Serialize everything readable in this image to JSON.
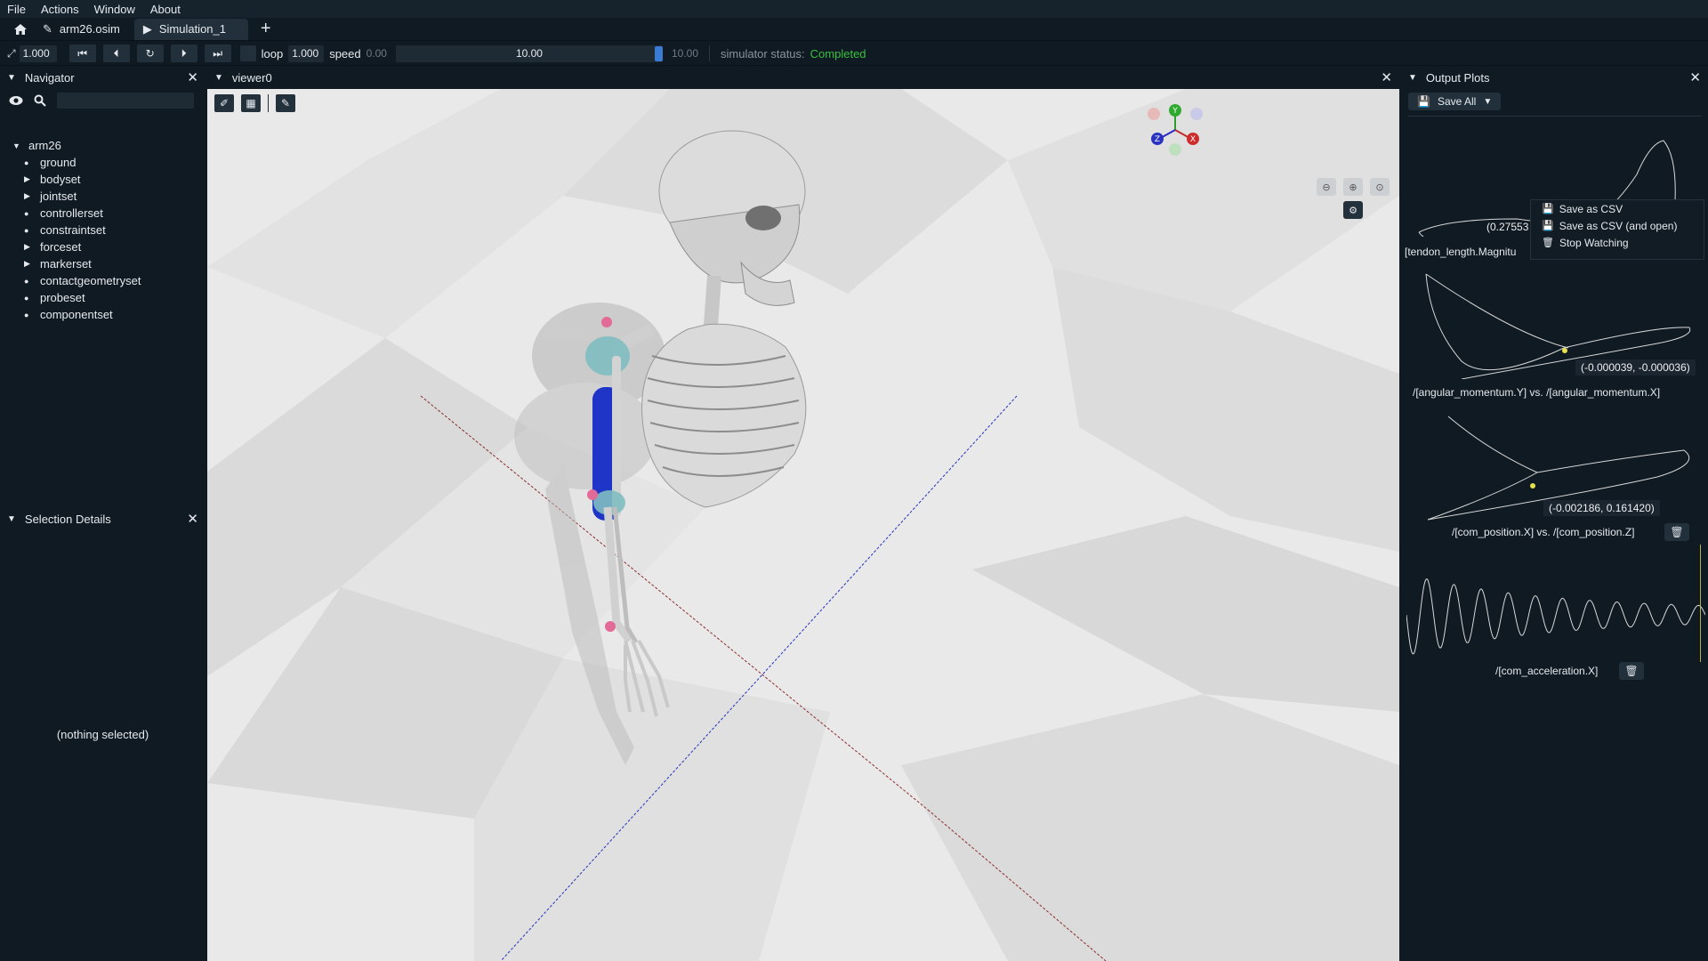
{
  "menu": [
    "File",
    "Actions",
    "Window",
    "About"
  ],
  "tabs": {
    "model_tab": "arm26.osim",
    "sim_tab": "Simulation_1",
    "add_symbol": "+"
  },
  "toolbar": {
    "scale_value": "1.000",
    "loop_label": "loop",
    "loop_value": "1.000",
    "speed_label": "speed",
    "time_start": "0.00",
    "time_current": "10.00",
    "time_end": "10.00",
    "status_label": "simulator status:",
    "status_value": "Completed",
    "status_color": "#38c03e"
  },
  "navigator": {
    "title": "Navigator",
    "root": "arm26",
    "items": [
      {
        "label": "ground",
        "expandable": false
      },
      {
        "label": "bodyset",
        "expandable": true
      },
      {
        "label": "jointset",
        "expandable": true
      },
      {
        "label": "controllerset",
        "expandable": false
      },
      {
        "label": "constraintset",
        "expandable": false
      },
      {
        "label": "forceset",
        "expandable": true
      },
      {
        "label": "markerset",
        "expandable": true
      },
      {
        "label": "contactgeometryset",
        "expandable": false
      },
      {
        "label": "probeset",
        "expandable": false
      },
      {
        "label": "componentset",
        "expandable": false
      }
    ]
  },
  "selection_details": {
    "title": "Selection Details",
    "empty_text": "(nothing selected)"
  },
  "viewer": {
    "title": "viewer0",
    "gizmo": {
      "y": "Y",
      "x": "X",
      "z": "Z"
    }
  },
  "output_plots": {
    "title": "Output Plots",
    "save_all": "Save All",
    "plot1": {
      "label": "[tendon_length.Magnitu",
      "tip": "(0.27553"
    },
    "plot2": {
      "label": "/[angular_momentum.Y] vs. /[angular_momentum.X]",
      "tip": "(-0.000039, -0.000036)"
    },
    "plot3": {
      "label": "/[com_position.X] vs. /[com_position.Z]",
      "tip": "(-0.002186, 0.161420)"
    },
    "plot4": {
      "label": "/[com_acceleration.X]"
    },
    "context_menu": [
      "Save as CSV",
      "Save as CSV (and open)",
      "Stop Watching"
    ]
  }
}
